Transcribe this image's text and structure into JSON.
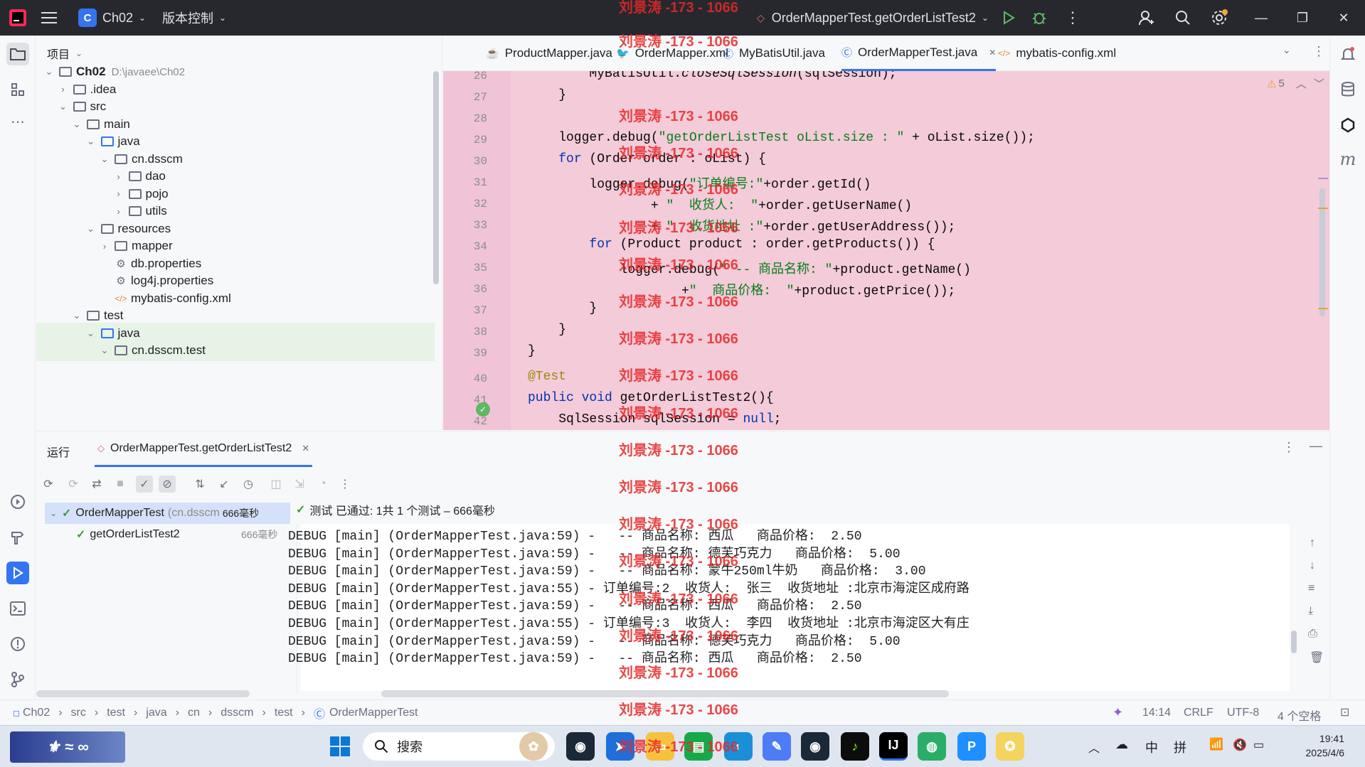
{
  "titlebar": {
    "project_name": "Ch02",
    "project_initial": "C",
    "vcs_label": "版本控制",
    "run_config": "OrderMapperTest.getOrderListTest2"
  },
  "project_panel": {
    "title": "项目",
    "tree": [
      {
        "label": "Ch02",
        "suffix": "D:\\javaee\\Ch02",
        "depth": 0,
        "chevron": "down",
        "kind": "module"
      },
      {
        "label": ".idea",
        "depth": 1,
        "chevron": "right",
        "kind": "folder"
      },
      {
        "label": "src",
        "depth": 1,
        "chevron": "down",
        "kind": "folder"
      },
      {
        "label": "main",
        "depth": 2,
        "chevron": "down",
        "kind": "folder"
      },
      {
        "label": "java",
        "depth": 3,
        "chevron": "down",
        "kind": "folder-blue"
      },
      {
        "label": "cn.dsscm",
        "depth": 4,
        "chevron": "down",
        "kind": "package"
      },
      {
        "label": "dao",
        "depth": 5,
        "chevron": "right",
        "kind": "package"
      },
      {
        "label": "pojo",
        "depth": 5,
        "chevron": "right",
        "kind": "package"
      },
      {
        "label": "utils",
        "depth": 5,
        "chevron": "right",
        "kind": "package"
      },
      {
        "label": "resources",
        "depth": 3,
        "chevron": "down",
        "kind": "folder"
      },
      {
        "label": "mapper",
        "depth": 4,
        "chevron": "right",
        "kind": "folder"
      },
      {
        "label": "db.properties",
        "depth": 4,
        "chevron": "",
        "kind": "gear-file"
      },
      {
        "label": "log4j.properties",
        "depth": 4,
        "chevron": "",
        "kind": "gear-file"
      },
      {
        "label": "mybatis-config.xml",
        "depth": 4,
        "chevron": "",
        "kind": "xml-file"
      },
      {
        "label": "test",
        "depth": 2,
        "chevron": "down",
        "kind": "folder"
      },
      {
        "label": "java",
        "depth": 3,
        "chevron": "down",
        "kind": "folder-blue"
      },
      {
        "label": "cn.dsscm.test",
        "depth": 4,
        "chevron": "down",
        "kind": "package"
      }
    ]
  },
  "editor": {
    "tabs": [
      {
        "label": "ProductMapper.java",
        "icon": "java-icon",
        "active": false
      },
      {
        "label": "OrderMapper.xml",
        "icon": "mybatis-icon",
        "active": false
      },
      {
        "label": "MyBatisUtil.java",
        "icon": "class-icon",
        "active": false
      },
      {
        "label": "OrderMapperTest.java",
        "icon": "class-icon",
        "active": true
      },
      {
        "label": "mybatis-config.xml",
        "icon": "xml-icon",
        "active": false
      }
    ],
    "warning_count": "5",
    "lines": [
      {
        "n": "26",
        "html": "        MyBatisUtil.<i>closeSqlSession</i>(sqlSession);"
      },
      {
        "n": "27",
        "html": "    }"
      },
      {
        "n": "28",
        "html": ""
      },
      {
        "n": "29",
        "html": "    logger.debug(<span class=\"str\">\"getOrderListTest oList.size : \"</span> + oList.size());"
      },
      {
        "n": "30",
        "html": "    <span class=\"kw\">for</span> (Order order : oList) {"
      },
      {
        "n": "31",
        "html": "        logger.debug(<span class=\"str\">\"订单编号:\"</span>+order.getId()"
      },
      {
        "n": "32",
        "html": "                + <span class=\"str\">\"  收货人:  \"</span>+order.getUserName()"
      },
      {
        "n": "33",
        "html": "                + <span class=\"str\">\"  收货地址 :\"</span>+order.getUserAddress());"
      },
      {
        "n": "34",
        "html": "        <span class=\"kw\">for</span> (Product product : order.getProducts()) {"
      },
      {
        "n": "35",
        "html": "            logger.debug(<span class=\"str\">\" -- 商品名称: \"</span>+product.getName()"
      },
      {
        "n": "36",
        "html": "                    +<span class=\"str\">\"  商品价格:  \"</span>+product.getPrice());"
      },
      {
        "n": "37",
        "html": "        }"
      },
      {
        "n": "38",
        "html": "    }"
      },
      {
        "n": "39",
        "html": "}"
      },
      {
        "n": "40",
        "html": "<span class=\"ann\">@Test</span>"
      },
      {
        "n": "41",
        "html": "<span class=\"kw\">public void</span> getOrderListTest2(){"
      },
      {
        "n": "42",
        "html": "    SqlSession sqlSession = <span class=\"kw\">null</span>;"
      }
    ]
  },
  "run_panel": {
    "title": "运行",
    "tab_label": "OrderMapperTest.getOrderListTest2",
    "status_text": "测试 已通过: 1共 1 个测试 – 666毫秒",
    "tests": [
      {
        "label": "OrderMapperTest",
        "suffix": "(cn.dsscm",
        "time": "666毫秒"
      },
      {
        "label": "getOrderListTest2",
        "suffix": "",
        "time": "666毫秒"
      }
    ],
    "console_lines": [
      "DEBUG [main] (OrderMapperTest.java:59) -   -- 商品名称: 西瓜   商品价格:  2.50",
      "DEBUG [main] (OrderMapperTest.java:59) -   -- 商品名称: 德芙巧克力   商品价格:  5.00",
      "DEBUG [main] (OrderMapperTest.java:59) -   -- 商品名称: 蒙牛250ml牛奶   商品价格:  3.00",
      "DEBUG [main] (OrderMapperTest.java:55) - 订单编号:2  收货人:  张三  收货地址 :北京市海淀区成府路",
      "DEBUG [main] (OrderMapperTest.java:59) -   -- 商品名称: 西瓜   商品价格:  2.50",
      "DEBUG [main] (OrderMapperTest.java:55) - 订单编号:3  收货人:  李四  收货地址 :北京市海淀区大有庄",
      "DEBUG [main] (OrderMapperTest.java:59) -   -- 商品名称: 德芙巧克力   商品价格:  5.00",
      "DEBUG [main] (OrderMapperTest.java:59) -   -- 商品名称: 西瓜   商品价格:  2.50"
    ]
  },
  "statusbar": {
    "breadcrumb": [
      "Ch02",
      "src",
      "test",
      "java",
      "cn",
      "dsscm",
      "test",
      "OrderMapperTest"
    ],
    "position": "14:14",
    "line_sep": "CRLF",
    "encoding": "UTF-8",
    "indent": "4 个空格"
  },
  "taskbar": {
    "search_placeholder": "搜索",
    "time": "19:41",
    "date": "2025/4/6",
    "ime_lang": "中",
    "ime_mode": "拼"
  },
  "watermark": "刘景涛 -173 - 1066",
  "colors": {
    "accent": "#3574f0",
    "editor_highlight": "#f3cbd9",
    "titlebar": "#27282e",
    "watermark": "#e62828"
  }
}
